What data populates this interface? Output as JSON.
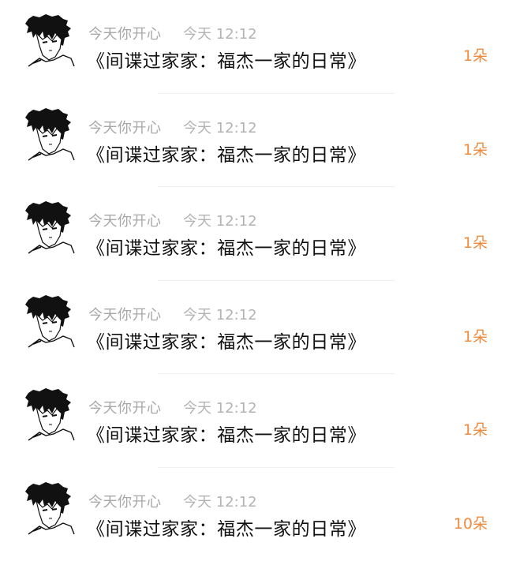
{
  "items": [
    {
      "username": "今天你开心",
      "time": "今天 12:12",
      "title": "《间谍过家家：福杰一家的日常》",
      "count": "1朵"
    },
    {
      "username": "今天你开心",
      "time": "今天 12:12",
      "title": "《间谍过家家：福杰一家的日常》",
      "count": "1朵"
    },
    {
      "username": "今天你开心",
      "time": "今天 12:12",
      "title": "《间谍过家家：福杰一家的日常》",
      "count": "1朵"
    },
    {
      "username": "今天你开心",
      "time": "今天 12:12",
      "title": "《间谍过家家：福杰一家的日常》",
      "count": "1朵"
    },
    {
      "username": "今天你开心",
      "time": "今天 12:12",
      "title": "《间谍过家家：福杰一家的日常》",
      "count": "1朵"
    },
    {
      "username": "今天你开心",
      "time": "今天 12:12",
      "title": "《间谍过家家：福杰一家的日常》",
      "count": "10朵"
    }
  ],
  "colors": {
    "count": "#f08a3c",
    "meta": "#a8a8a8",
    "title": "#111111"
  },
  "avatar_icon": "manga-boy-avatar-icon"
}
